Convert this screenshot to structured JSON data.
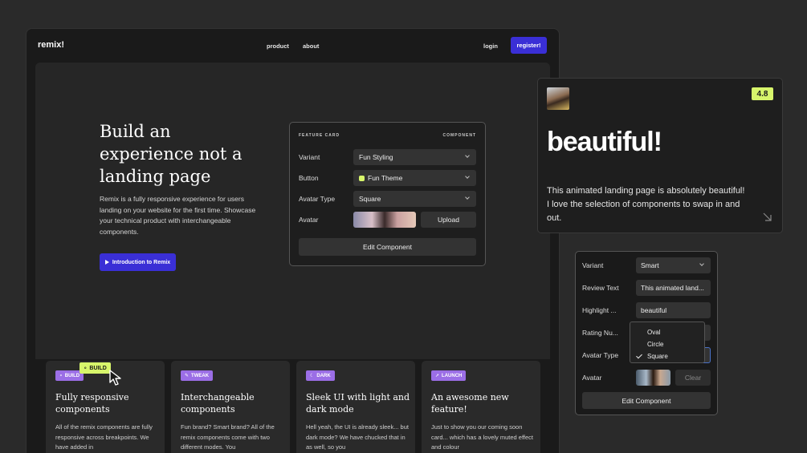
{
  "nav": {
    "logo": "remix!",
    "links": [
      "product",
      "about"
    ],
    "login": "login",
    "register": "register!"
  },
  "hero": {
    "title": "Build an experience not a landing page",
    "description": "Remix is a fully responsive experience for users landing on your website for the first time. Showcase your technical product with interchangeable components.",
    "cta": "Introduction to Remix"
  },
  "feature_panel": {
    "header_left": "FEATURE CARD",
    "header_right": "COMPONENT",
    "rows": [
      {
        "label": "Variant",
        "value": "Fun Styling"
      },
      {
        "label": "Button",
        "value": "Fun Theme"
      },
      {
        "label": "Avatar Type",
        "value": "Square"
      },
      {
        "label": "Avatar",
        "action": "Upload"
      }
    ],
    "edit_button": "Edit Component",
    "swatch_color": "#d7f56b"
  },
  "cards": [
    {
      "badge": "BUILD",
      "title": "Fully responsive components",
      "body": "All of the remix components are fully responsive across breakpoints. We have added in"
    },
    {
      "badge": "TWEAK",
      "title": "Interchangeable components",
      "body": "Fun brand? Smart brand? All of the remix components come with two different modes. You"
    },
    {
      "badge": "DARK",
      "title": "Sleek UI with light and dark mode",
      "body": "Hell yeah, the UI is already sleek... but dark mode? We have chucked that in as well, so you"
    },
    {
      "badge": "LAUNCH",
      "title": "An awesome new feature!",
      "body": "Just to show you our coming soon card... which has a lovely muted effect and colour"
    }
  ],
  "build_tag": "BUILD",
  "review": {
    "rating": "4.8",
    "highlight": "beautiful!",
    "text": "This animated landing page is absolutely beautiful! I love the selection of components to swap in and out."
  },
  "edit_panel": {
    "rows": [
      {
        "label": "Variant",
        "value": "Smart"
      },
      {
        "label": "Review Text",
        "value": "This animated land..."
      },
      {
        "label": "Highlight ...",
        "value": "beautiful"
      },
      {
        "label": "Rating Nu...",
        "value": ""
      },
      {
        "label": "Avatar Type",
        "value": ""
      },
      {
        "label": "Avatar",
        "action": "Clear"
      }
    ],
    "edit_button": "Edit Component",
    "dropdown": {
      "options": [
        "Oval",
        "Circle",
        "Square"
      ],
      "selected": "Square"
    }
  },
  "colors": {
    "accent": "#3a2fd6",
    "highlight": "#d7f56b",
    "badge": "#9b6ee6",
    "focus": "#4a72c8"
  }
}
